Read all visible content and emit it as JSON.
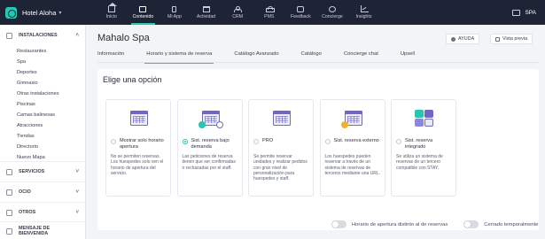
{
  "topbar": {
    "hotel_name": "Hotel Aloha",
    "nav": [
      {
        "label": "Inicio",
        "icon": "home-icon"
      },
      {
        "label": "Contenido",
        "icon": "content-icon"
      },
      {
        "label": "Mi App",
        "icon": "phone-icon"
      },
      {
        "label": "Actividad",
        "icon": "calendar-icon"
      },
      {
        "label": "CRM",
        "icon": "people-icon"
      },
      {
        "label": "PMS",
        "icon": "pms-icon"
      },
      {
        "label": "Feedback",
        "icon": "thumb-icon"
      },
      {
        "label": "Concierge",
        "icon": "chat-icon"
      },
      {
        "label": "Insights",
        "icon": "chart-icon"
      }
    ],
    "active_nav": "Contenido",
    "language": "SPA"
  },
  "sidebar": {
    "sections": [
      {
        "label": "INSTALACIONES",
        "icon": "building-icon",
        "expanded": true,
        "items": [
          "Restaurantes",
          "Spa",
          "Deportes",
          "Gimnasio",
          "Otras instalaciones",
          "Piscinas",
          "Camas balinesas",
          "Atracciones",
          "Tiendas",
          "Directorio",
          "Nuevo Mapa"
        ]
      },
      {
        "label": "SERVICIOS",
        "icon": "services-icon",
        "expanded": false
      },
      {
        "label": "OCIO",
        "icon": "leisure-icon",
        "expanded": false
      },
      {
        "label": "OTROS",
        "icon": "others-icon",
        "expanded": false
      },
      {
        "label": "MENSAJE DE BIENVENIDA",
        "icon": "welcome-icon",
        "expanded": false
      }
    ]
  },
  "main": {
    "title": "Mahalo Spa",
    "help_label": "AYUDA",
    "preview_label": "Vista previa",
    "tabs": [
      "Información",
      "Horario y sistema de reserva",
      "Catálogo Avanzado",
      "Catálogo",
      "Concierge chat",
      "Upsell"
    ],
    "active_tab": "Horario y sistema de reserva",
    "panel_title": "Elige una opción",
    "options": [
      {
        "label": "Mostrar solo horario apertura",
        "desc": "No se permiten reservas. Los huespedes solo ven el horario de apertura del servicio.",
        "selected": false,
        "illustration": "calendar-icon"
      },
      {
        "label": "Sist. reserva bajo demanda",
        "desc": "Las peticiones de reserva tienen que ser confirmadas o rechazadas por el staff.",
        "selected": true,
        "illustration": "calendar-check-icon"
      },
      {
        "label": "PRO",
        "desc": "Se permite reservar unidades y realizar pedidos con gran nivel de personalización para huespedes y staff.",
        "selected": false,
        "illustration": "calendar-icon"
      },
      {
        "label": "Sist. reserva externo",
        "desc": "Los huespedes pueden reservar a través de un sistema de reservas de terceros mediante una URL.",
        "selected": false,
        "illustration": "calendar-link-icon"
      },
      {
        "label": "Sist. reserva integrado",
        "desc": "Se utiliza un sistema de reservas de un tercero compatible con STAY.",
        "selected": false,
        "illustration": "puzzle-icon"
      }
    ],
    "toggles": [
      {
        "label": "Horario de apertura distinto al de reservas",
        "on": false
      },
      {
        "label": "Cerrado temporalmente",
        "on": false
      }
    ]
  },
  "colors": {
    "accent": "#27c6b0",
    "topbar": "#1f2336",
    "illustration": "#6f66c8"
  }
}
